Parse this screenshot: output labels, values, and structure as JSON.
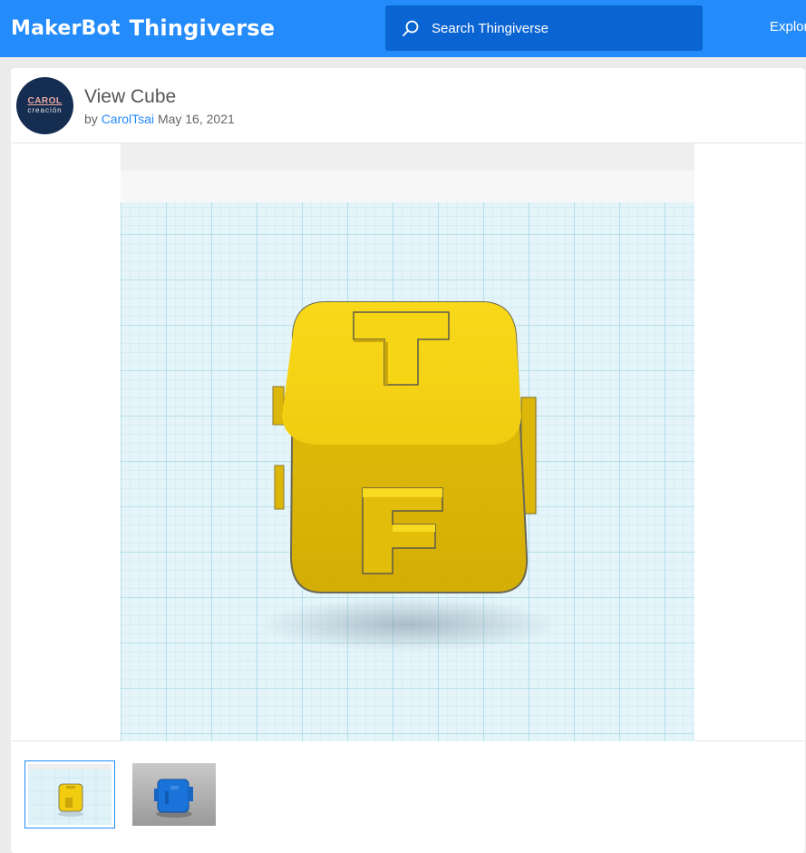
{
  "header": {
    "brand": "MakerBot",
    "product": "Thingiverse",
    "search_placeholder": "Search Thingiverse",
    "explore_label": "Explor"
  },
  "thing": {
    "title": "View Cube",
    "by_label": "by",
    "author": "CarolTsai",
    "date": "May 16, 2021",
    "avatar": {
      "line1": "CAROL",
      "line2": "creación"
    }
  },
  "main_image": {
    "top_letter": "T",
    "front_letter": "F",
    "cube_color": "#f5d112"
  },
  "thumbnails": [
    {
      "name": "yellow-view-cube",
      "selected": true,
      "color": "#f5d112"
    },
    {
      "name": "blue-view-cube",
      "selected": false,
      "color": "#1a73d9"
    }
  ],
  "colors": {
    "accent": "#248bfb",
    "search_bg": "#0a64d2",
    "grid": "#bde7f2"
  }
}
